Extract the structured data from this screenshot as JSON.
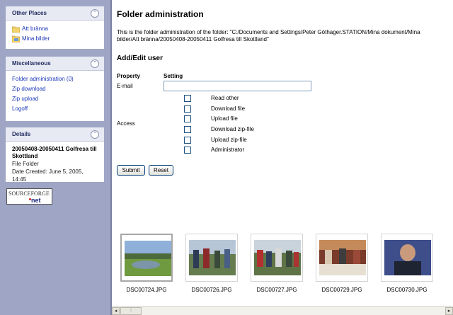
{
  "sidebar": {
    "other_places": {
      "title": "Other Places",
      "items": [
        {
          "label": "Att bränna",
          "icon": "folder-icon"
        },
        {
          "label": "Mina bilder",
          "icon": "pictures-folder-icon"
        }
      ]
    },
    "miscellaneous": {
      "title": "Miscellaneous",
      "items": [
        {
          "label": "Folder administration (0)"
        },
        {
          "label": "Zip download"
        },
        {
          "label": "Zip upload"
        },
        {
          "label": "Logoff"
        }
      ]
    },
    "details": {
      "title": "Details",
      "name": "20050408-20050411 Golfresa till Skottland",
      "type": "File Folder",
      "created": "Date Created: June 5, 2005, 14:45"
    },
    "logo": {
      "top": "SOURCEFORGE",
      "bottom": "net"
    }
  },
  "main": {
    "title": "Folder administration",
    "intro": "This is the folder administration of the folder: \"C:/Documents and Settings/Peter Göthager.STATION/Mina dokument/Mina bilder/Att bränna/20050408-20050411 Golfresa till Skottland\"",
    "section_title": "Add/Edit user",
    "col_property": "Property",
    "col_setting": "Setting",
    "email_label": "E-mail",
    "email_value": "",
    "access_label": "Access",
    "permissions": [
      {
        "label": "Read other",
        "checked": false
      },
      {
        "label": "Download file",
        "checked": false
      },
      {
        "label": "Upload file",
        "checked": false
      },
      {
        "label": "Download zip-file",
        "checked": false
      },
      {
        "label": "Upload zip-file",
        "checked": false
      },
      {
        "label": "Administrator",
        "checked": false
      }
    ],
    "submit_label": "Submit",
    "reset_label": "Reset"
  },
  "gallery": [
    {
      "caption": "DSC00724.JPG",
      "selected": true
    },
    {
      "caption": "DSC00726.JPG",
      "selected": false
    },
    {
      "caption": "DSC00727.JPG",
      "selected": false
    },
    {
      "caption": "DSC00729.JPG",
      "selected": false
    },
    {
      "caption": "DSC00730.JPG",
      "selected": false
    }
  ],
  "colors": {
    "sidebar_bg": "#9fa6c5",
    "link": "#1a35b8",
    "panel_header": "#e7e9f3"
  }
}
